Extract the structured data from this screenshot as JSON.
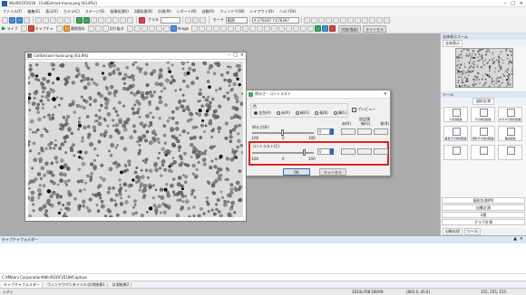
{
  "app": {
    "title": "WinROOF2018 - [CellExtract-mono.png (63.8%)]",
    "accent": "#1e5fa8"
  },
  "menu": [
    "ファイル(F)",
    "編集(E)",
    "表示(V)",
    "カメラ(C)",
    "ステージ(S)",
    "画像処理(I)",
    "2値処理(B)",
    "計測(M)",
    "レポート(R)",
    "自動(A)",
    "ウィンドウ(W)",
    "レイアウト(O)",
    "ヘルプ(H)"
  ],
  "toolbar": {
    "class_label": "クラス",
    "mode_label": "モード",
    "mode_value": "範囲",
    "coord": "X:278287 Y:278287",
    "live_label": "ライブ",
    "capture_label": "キャプチャ",
    "continuous_label": "連続保存",
    "cut_label": "切り抜き",
    "image_label": "Image",
    "crop_label": "切抜(描画)",
    "cancel_label": "キャンセル"
  },
  "image_window": {
    "title": "CellExtract-mono.png (63.8%)"
  },
  "dialog": {
    "title": "明るさ・コントラスト",
    "channel_label": "色",
    "channels": [
      "全色(A)",
      "赤(R)",
      "緑(G)",
      "青(B)",
      "輝(L)"
    ],
    "preview_label": "プレビュー",
    "brightness_label": "明るさ(B):",
    "brightness_value": "0",
    "brightness_min": "-100",
    "brightness_mid": "0",
    "brightness_max": "100",
    "ref_label": "設定値",
    "col_headers": [
      "赤(R)",
      "緑(G)",
      "青(B)"
    ],
    "contrast_label": "コントラスト(C):",
    "contrast_value": "0",
    "contrast_min": "-100",
    "contrast_mid": "0",
    "contrast_max": "100",
    "ok_label": "OK",
    "cancel_label": "キャンセル",
    "highlight_color": "#e02020"
  },
  "right_panel": {
    "overview_title": "全体表示ズーム",
    "overview_tab": "全体表示",
    "tools_title": "ツール",
    "tools_tab": "図形計測",
    "tools": [
      "2点間距離",
      "平行線間距離",
      "水平平行線間距離",
      "垂直平行線間距離",
      "傾斜平行線間距離",
      "垂線距離",
      "",
      "",
      ""
    ],
    "buttons": [
      "図形計測(M)",
      "自動計測",
      "2値",
      "グラフ計測"
    ],
    "bottom_tabs": [
      "自動処理",
      "ツール"
    ]
  },
  "bottom": {
    "panel_title": "キャプチャフォルダー",
    "path": "C:¥Mitani Corporation¥WinROOF2018¥Capture",
    "tabs": [
      "キャプチャフォルダー",
      "ウィンドウアンタイトル:計測結果1",
      "計測結果2"
    ],
    "status_left": "レディ",
    "status_size": "1024x768 GRAY8",
    "status_pos": "(865.0, 45.0)",
    "status_rgb": "155, 155, 155"
  }
}
